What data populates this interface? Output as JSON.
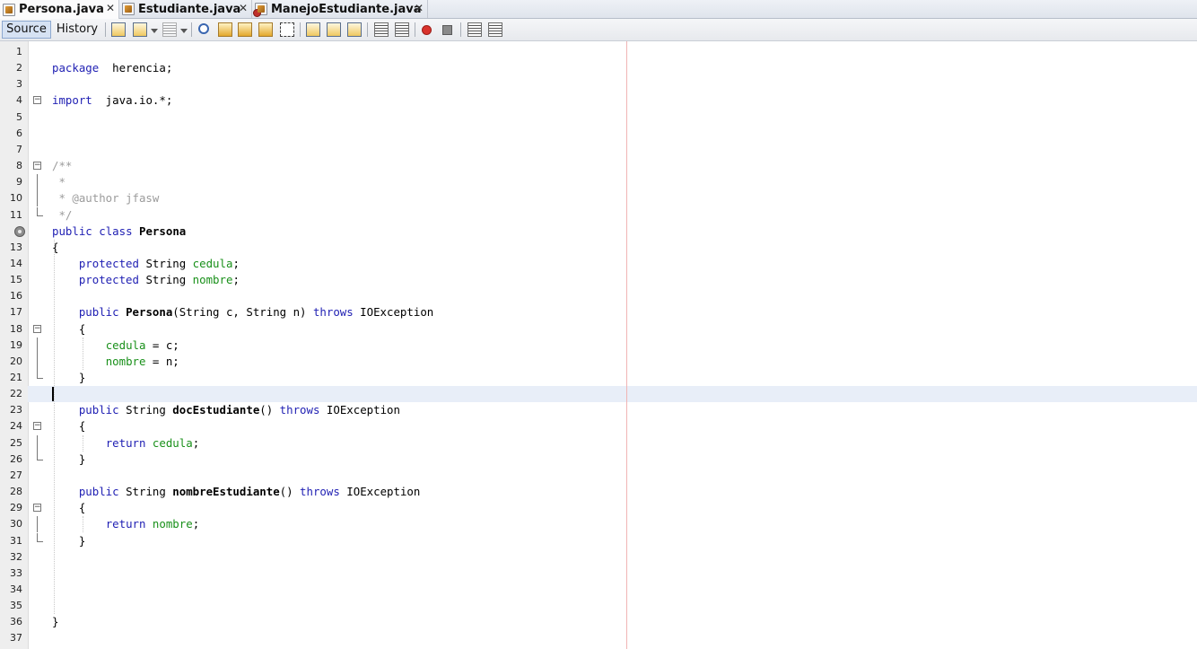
{
  "tabs": [
    {
      "label": "Persona.java",
      "active": true,
      "icon": "java-file-icon"
    },
    {
      "label": "Estudiante.java",
      "active": false,
      "icon": "java-file-icon"
    },
    {
      "label": "ManejoEstudiante.java",
      "active": false,
      "icon": "java-file-error-icon"
    }
  ],
  "tab_close_glyph": "✕",
  "toolbar": {
    "source_label": "Source",
    "history_label": "History"
  },
  "editor": {
    "current_line": 22,
    "line_numbers": [
      "1",
      "2",
      "3",
      "4",
      "5",
      "6",
      "7",
      "8",
      "9",
      "10",
      "11",
      "12",
      "13",
      "14",
      "15",
      "16",
      "17",
      "18",
      "19",
      "20",
      "21",
      "22",
      "23",
      "24",
      "25",
      "26",
      "27",
      "28",
      "29",
      "30",
      "31",
      "32",
      "33",
      "34",
      "35",
      "36",
      "37"
    ],
    "lines": [
      [],
      [
        [
          "kw",
          "package"
        ],
        [
          "",
          "  herencia;"
        ]
      ],
      [],
      [
        [
          "kw",
          "import"
        ],
        [
          "",
          "  java.io.*;"
        ]
      ],
      [],
      [],
      [],
      [
        [
          "cmt",
          "/**"
        ]
      ],
      [
        [
          "cmt",
          " *"
        ]
      ],
      [
        [
          "cmt",
          " * @author jfasw"
        ]
      ],
      [
        [
          "cmt",
          " */"
        ]
      ],
      [
        [
          "kw",
          "public"
        ],
        [
          "",
          " "
        ],
        [
          "kw",
          "class"
        ],
        [
          "",
          " "
        ],
        [
          "bold",
          "Persona"
        ]
      ],
      [
        [
          "",
          "{"
        ]
      ],
      [
        [
          "",
          "    "
        ],
        [
          "kw",
          "protected"
        ],
        [
          "",
          " String "
        ],
        [
          "fld",
          "cedula"
        ],
        [
          "",
          ";"
        ]
      ],
      [
        [
          "",
          "    "
        ],
        [
          "kw",
          "protected"
        ],
        [
          "",
          " String "
        ],
        [
          "fld",
          "nombre"
        ],
        [
          "",
          ";"
        ]
      ],
      [],
      [
        [
          "",
          "    "
        ],
        [
          "kw",
          "public"
        ],
        [
          "",
          " "
        ],
        [
          "bold",
          "Persona"
        ],
        [
          "",
          "(String c, String n) "
        ],
        [
          "kw",
          "throws"
        ],
        [
          "",
          " IOException"
        ]
      ],
      [
        [
          "",
          "    {"
        ]
      ],
      [
        [
          "",
          "        "
        ],
        [
          "fld",
          "cedula"
        ],
        [
          "",
          " = c;"
        ]
      ],
      [
        [
          "",
          "        "
        ],
        [
          "fld",
          "nombre"
        ],
        [
          "",
          " = n;"
        ]
      ],
      [
        [
          "",
          "    }"
        ]
      ],
      [],
      [
        [
          "",
          "    "
        ],
        [
          "kw",
          "public"
        ],
        [
          "",
          " String "
        ],
        [
          "bold",
          "docEstudiante"
        ],
        [
          "",
          "() "
        ],
        [
          "kw",
          "throws"
        ],
        [
          "",
          " IOException"
        ]
      ],
      [
        [
          "",
          "    {"
        ]
      ],
      [
        [
          "",
          "        "
        ],
        [
          "kw",
          "return"
        ],
        [
          "",
          " "
        ],
        [
          "fld",
          "cedula"
        ],
        [
          "",
          ";"
        ]
      ],
      [
        [
          "",
          "    }"
        ]
      ],
      [],
      [
        [
          "",
          "    "
        ],
        [
          "kw",
          "public"
        ],
        [
          "",
          " String "
        ],
        [
          "bold",
          "nombreEstudiante"
        ],
        [
          "",
          "() "
        ],
        [
          "kw",
          "throws"
        ],
        [
          "",
          " IOException"
        ]
      ],
      [
        [
          "",
          "    {"
        ]
      ],
      [
        [
          "",
          "        "
        ],
        [
          "kw",
          "return"
        ],
        [
          "",
          " "
        ],
        [
          "fld",
          "nombre"
        ],
        [
          "",
          ";"
        ]
      ],
      [
        [
          "",
          "    }"
        ]
      ],
      [],
      [],
      [],
      [],
      [
        [
          "",
          "}"
        ]
      ],
      []
    ]
  },
  "colors": {
    "keyword": "#1f1fb3",
    "field": "#19901a",
    "comment": "#9b9b9b",
    "current_line_bg": "#e8eef8",
    "right_margin": "#f0b4b4"
  }
}
